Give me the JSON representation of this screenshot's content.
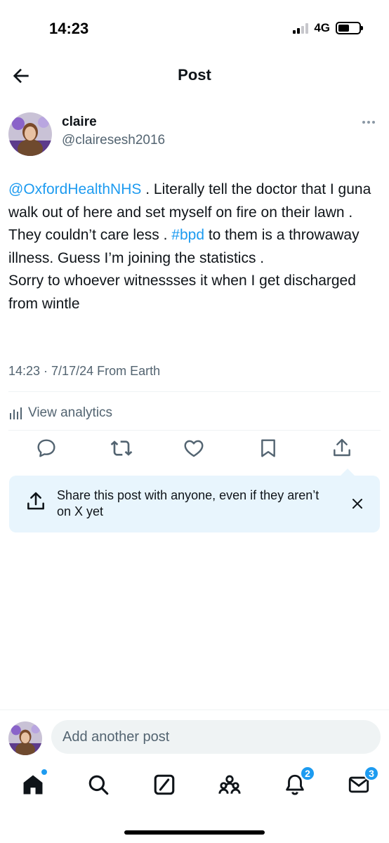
{
  "status_bar": {
    "time": "14:23",
    "network": "4G"
  },
  "header": {
    "title": "Post"
  },
  "author": {
    "name": "claire",
    "handle": "@clairesesh2016"
  },
  "post": {
    "mention": "@OxfordHealthNHS",
    "text_part1": " . Literally tell the doctor that I guna walk out of here and set myself on fire on their lawn . They couldn’t care less . ",
    "hashtag": "#bpd",
    "text_part2": " to them is a throwaway illness. Guess I’m joining the statistics .",
    "text_part3": "Sorry to whoever witnessses it when I get discharged from wintle",
    "timestamp": "14:23 · 7/17/24 From Earth",
    "analytics_label": "View analytics"
  },
  "icons": {
    "back": "arrow-left-icon",
    "more": "more-dots-icon",
    "reply": "reply-bubble-icon",
    "repost": "repost-icon",
    "like": "heart-icon",
    "bookmark": "bookmark-icon",
    "share": "share-upload-icon",
    "close": "close-icon",
    "home": "home-icon",
    "search": "search-icon",
    "grok": "grok-icon",
    "communities": "communities-icon",
    "notifications": "bell-icon",
    "messages": "mail-icon"
  },
  "share_banner": {
    "text": "Share this post with anyone, even if they aren’t on X yet"
  },
  "reply": {
    "placeholder": "Add another post"
  },
  "tab_bar": {
    "notifications_badge": "2",
    "messages_badge": "3"
  },
  "colors": {
    "accent": "#1d9bf0",
    "text": "#0f1419",
    "secondary": "#536471",
    "banner_bg": "#e8f5fd"
  }
}
